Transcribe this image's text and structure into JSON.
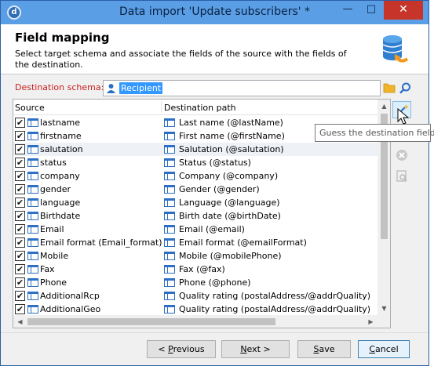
{
  "window": {
    "title": "Data import 'Update subscribers' *",
    "controls": [
      "minimize",
      "maximize",
      "close"
    ]
  },
  "header": {
    "heading": "Field mapping",
    "description": "Select target schema and associate the fields of the source with the fields of the destination.",
    "icon": "database-refresh-icon"
  },
  "schema": {
    "label": "Destination schema:",
    "value": "Recipient"
  },
  "grid": {
    "columns": {
      "source": "Source",
      "destination": "Destination path"
    },
    "rows": [
      {
        "checked": true,
        "source": "lastname",
        "destination": "Last name (@lastName)"
      },
      {
        "checked": true,
        "source": "firstname",
        "destination": "First name (@firstName)"
      },
      {
        "checked": true,
        "source": "salutation",
        "destination": "Salutation (@salutation)"
      },
      {
        "checked": true,
        "source": "status",
        "destination": "Status (@status)"
      },
      {
        "checked": true,
        "source": "company",
        "destination": "Company (@company)"
      },
      {
        "checked": true,
        "source": "gender",
        "destination": "Gender (@gender)"
      },
      {
        "checked": true,
        "source": "language",
        "destination": "Language (@language)"
      },
      {
        "checked": true,
        "source": "Birthdate",
        "destination": "Birth date (@birthDate)"
      },
      {
        "checked": true,
        "source": "Email",
        "destination": "Email (@email)"
      },
      {
        "checked": true,
        "source": "Email format (Email_format)",
        "destination": "Email format (@emailFormat)"
      },
      {
        "checked": true,
        "source": "Mobile",
        "destination": "Mobile (@mobilePhone)"
      },
      {
        "checked": true,
        "source": "Fax",
        "destination": "Fax (@fax)"
      },
      {
        "checked": true,
        "source": "Phone",
        "destination": "Phone (@phone)"
      },
      {
        "checked": true,
        "source": "AdditionalRcp",
        "destination": "Quality rating (postalAddress/@addrQuality)"
      },
      {
        "checked": true,
        "source": "AdditionalGeo",
        "destination": "Quality rating (postalAddress/@addrQuality)"
      }
    ],
    "highlighted_row": 2
  },
  "tooltip": "Guess the destination field",
  "buttons": {
    "previous": {
      "prefix": "< ",
      "accel": "P",
      "rest": "revious"
    },
    "next": {
      "accel": "N",
      "rest": "ext >"
    },
    "save": {
      "accel": "S",
      "rest": "ave"
    },
    "cancel": {
      "accel": "C",
      "rest": "ancel"
    }
  },
  "colors": {
    "titlebar": "#5a9ee6",
    "close_button": "#c7352a",
    "required_label": "#c81e1e",
    "selection": "#3399ff",
    "field_icon": "#2c6fc4"
  }
}
